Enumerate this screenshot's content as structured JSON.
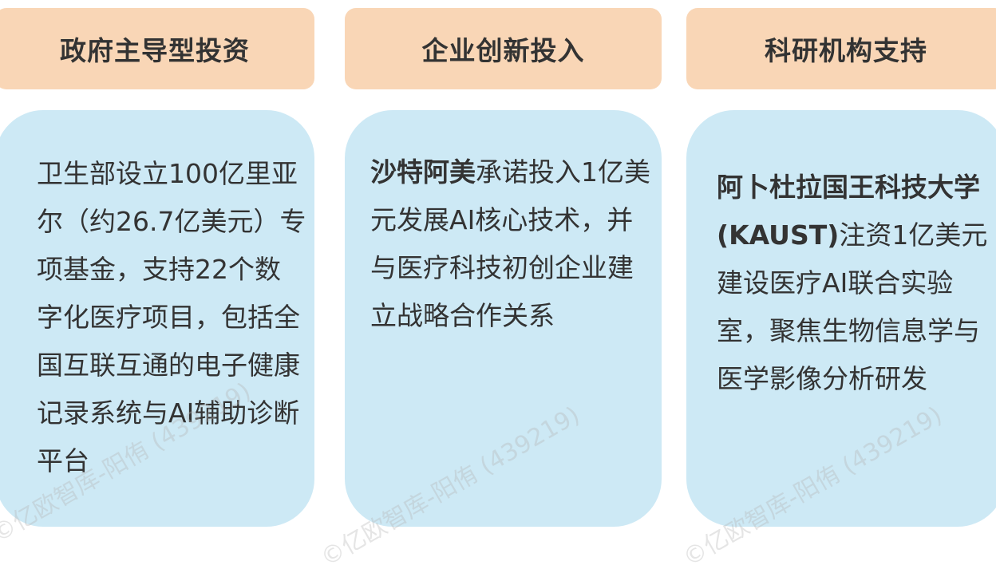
{
  "columns": [
    {
      "header": "政府主导型投资",
      "body_bold": "",
      "body": "卫生部设立100亿里亚尔（约26.7亿美元）专项基金，支持22个数字化医疗项目，包括全国互联互通的电子健康记录系统与AI辅助诊断平台"
    },
    {
      "header": "企业创新投入",
      "body_bold": "沙特阿美",
      "body": "承诺投入1亿美元发展AI核心技术，并与医疗科技初创企业建立战略合作关系"
    },
    {
      "header": "科研机构支持",
      "body_bold": "阿卜杜拉国王科技大学(KAUST)",
      "body": "注资1亿美元建设医疗AI联合实验室，聚焦生物信息学与医学影像分析研发"
    }
  ],
  "watermark": "©亿欧智库-阳侑 (439219)",
  "colors": {
    "header_bg": "#f9d6b6",
    "card_bg": "#cde9f5",
    "text": "#333333"
  }
}
